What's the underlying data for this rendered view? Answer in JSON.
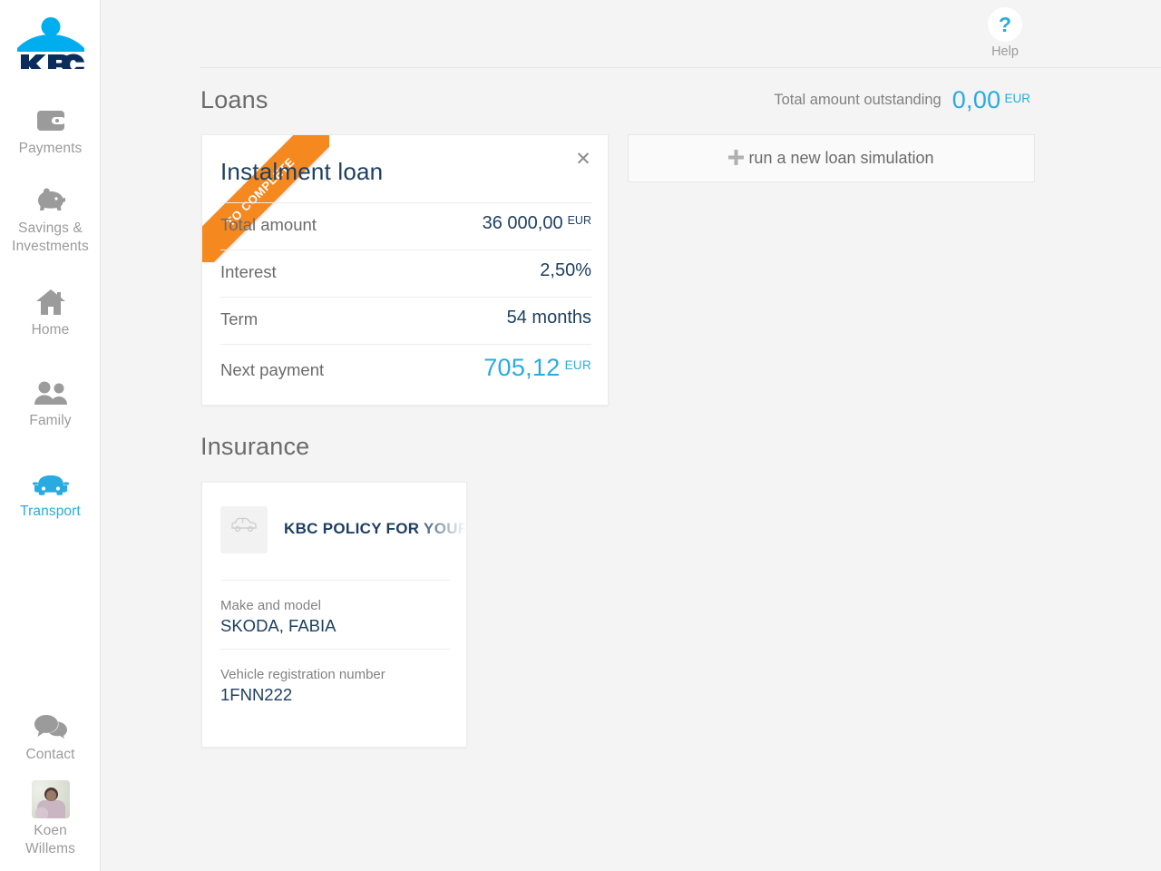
{
  "brand": {
    "logo_text": "KBC",
    "accent_blue": "#29abe2",
    "navy": "#1d3f62",
    "orange": "#f5881f",
    "grey_text": "#6b6b6b"
  },
  "sidebar": {
    "items": [
      {
        "label": "Payments",
        "icon": "wallet-icon",
        "active": false
      },
      {
        "label": "Savings & Investments",
        "icon": "piggy-bank-icon",
        "active": false
      },
      {
        "label": "Home",
        "icon": "house-icon",
        "active": false
      },
      {
        "label": "Family",
        "icon": "family-icon",
        "active": false
      },
      {
        "label": "Transport",
        "icon": "car-icon",
        "active": true
      },
      {
        "label": "Contact",
        "icon": "chat-bubbles-icon",
        "active": false
      }
    ],
    "user": {
      "first_name": "Koen",
      "last_name": "Willems",
      "avatar": "user-photo"
    }
  },
  "header": {
    "help_label": "Help",
    "help_icon": "question-mark-icon"
  },
  "loans": {
    "section_title": "Loans",
    "outstanding_label": "Total amount outstanding",
    "outstanding_value": "0,00",
    "outstanding_currency": "EUR",
    "simulation_button": "run a new loan simulation",
    "card": {
      "ribbon": "TO COMPLETE",
      "title": "Instalment loan",
      "close_icon": "close-icon",
      "rows": [
        {
          "label": "Total amount",
          "value": "36 000,00",
          "currency": "EUR",
          "highlight": false
        },
        {
          "label": "Interest",
          "value": "2,50%",
          "currency": "",
          "highlight": false
        },
        {
          "label": "Term",
          "value": "54 months",
          "currency": "",
          "highlight": false
        },
        {
          "label": "Next payment",
          "value": "705,12",
          "currency": "EUR",
          "highlight": true
        }
      ]
    }
  },
  "insurance": {
    "section_title": "Insurance",
    "card": {
      "icon": "car-outline-icon",
      "policy_name": "KBC POLICY FOR YOUR",
      "fields": [
        {
          "label": "Make and model",
          "value": "SKODA, FABIA"
        },
        {
          "label": "Vehicle registration number",
          "value": "1FNN222"
        }
      ]
    }
  }
}
